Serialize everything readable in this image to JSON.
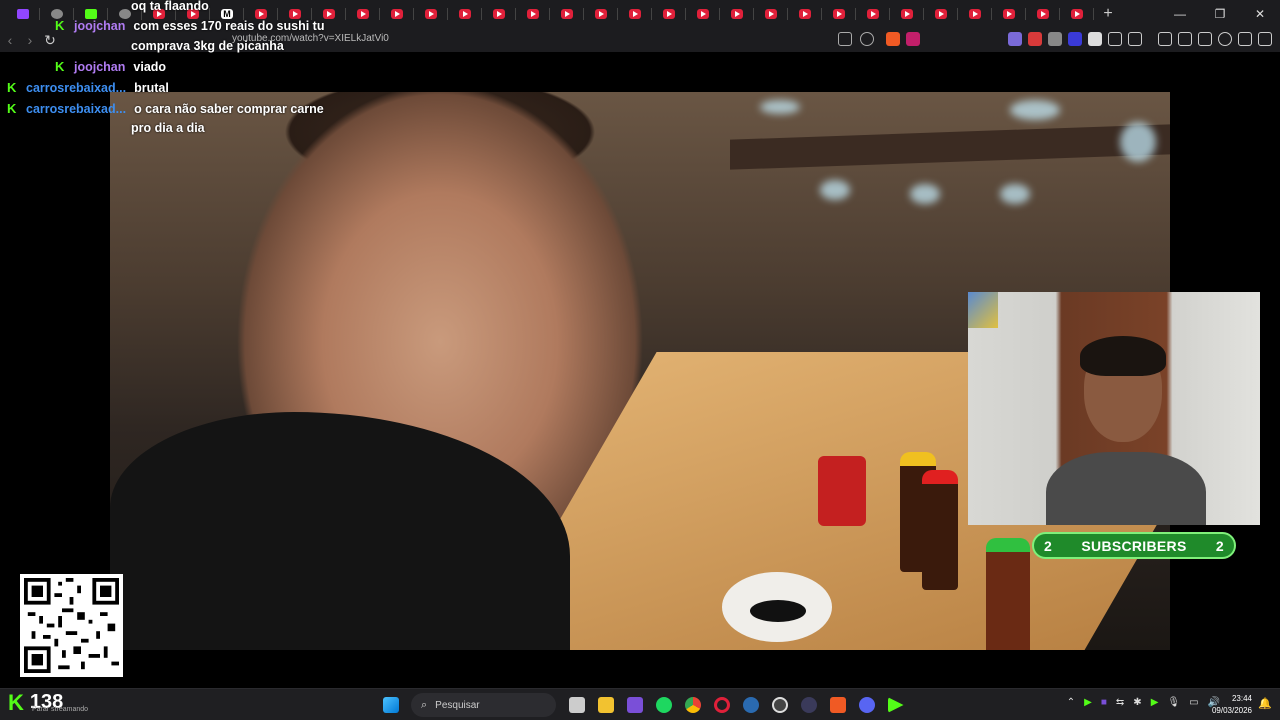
{
  "browser": {
    "url": "youtube.com/watch?v=XIELkJatVi0",
    "new_tab": "+",
    "controls": {
      "minimize": "—",
      "maximize": "❐",
      "close": "✕"
    }
  },
  "chat": {
    "messages": [
      {
        "user": "",
        "text": "oq ta flaando",
        "color": "#ffffff"
      },
      {
        "user": "joojchan",
        "text": "com esses 170 reais do sushi tu",
        "color": "#b07cf2"
      },
      {
        "user": "",
        "text": "comprava 3kg de picanha",
        "color": "#ffffff"
      },
      {
        "user": "joojchan",
        "text": "viado",
        "color": "#b07cf2"
      },
      {
        "user": "carrosrebaixad...",
        "text": "brutal",
        "color": "#3d8ef0"
      },
      {
        "user": "carrosrebaixad...",
        "text": "o cara não saber comprar carne",
        "color": "#3d8ef0"
      },
      {
        "user": "",
        "text": "pro dia a dia",
        "color": "#ffffff"
      }
    ]
  },
  "overlay": {
    "subscribers_label": "SUBSCRIBERS",
    "subscribers_left": "2",
    "subscribers_right": "2"
  },
  "taskbar": {
    "viewer_count": "138",
    "status_text": "Parar streamando",
    "search_placeholder": "Pesquisar",
    "time": "23:44",
    "date": "09/03/2026"
  },
  "colors": {
    "kick_green": "#53fc18",
    "subs_bg": "#1f8a2a",
    "subs_border": "#7ff07a"
  }
}
